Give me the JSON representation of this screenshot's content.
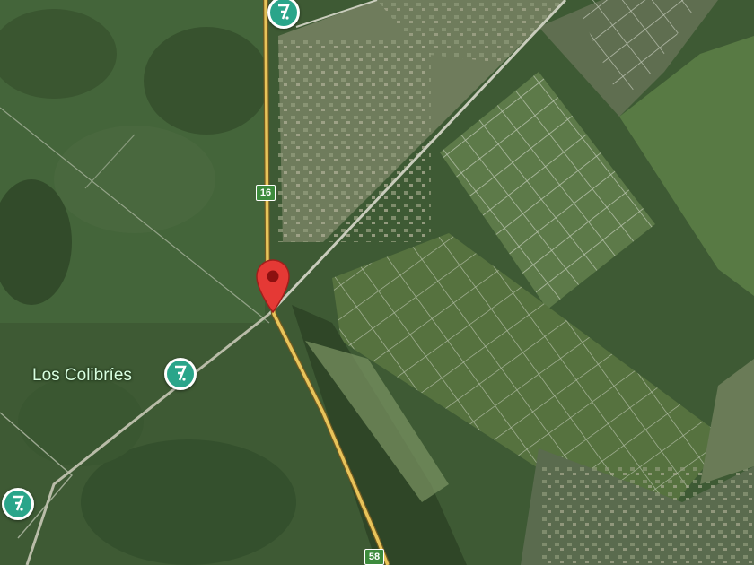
{
  "map": {
    "type": "satellite",
    "colors": {
      "field_dark": "#3e5a34",
      "field_light": "#6e8a58",
      "road_highway": "#e8c45a",
      "road_local": "#d9dcd0",
      "poi": "#2aa58a",
      "pin": "#e53935",
      "shield": "#3d8b3d"
    },
    "route_shields": [
      {
        "label": "16"
      },
      {
        "label": "58"
      }
    ],
    "places": [
      {
        "label": "Los Colibríes",
        "icon": "recreation-icon"
      }
    ],
    "pois": [
      {
        "icon": "recreation-icon"
      },
      {
        "icon": "recreation-icon"
      },
      {
        "icon": "recreation-icon"
      }
    ],
    "pin": {
      "icon": "location-pin-icon"
    }
  }
}
